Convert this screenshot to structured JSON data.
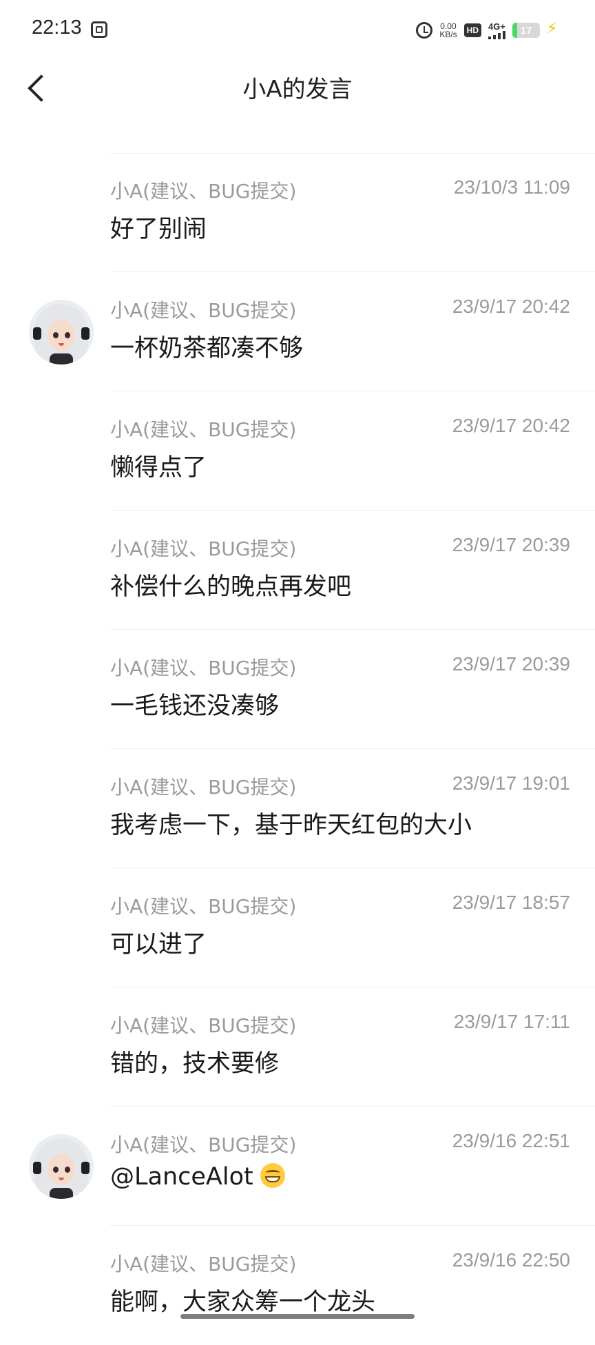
{
  "status_bar": {
    "time": "22:13",
    "net_speed_value": "0.00",
    "net_speed_unit": "KB/s",
    "hd_label": "HD",
    "network_label": "4G+",
    "battery_level": "17",
    "battery_fraction": 0.17
  },
  "header": {
    "title": "小A的发言"
  },
  "posts": [
    {
      "author": "小A(建议、BUG提交)",
      "time": "23/10/3 11:09",
      "content": "好了别闹",
      "avatar": false
    },
    {
      "author": "小A(建议、BUG提交)",
      "time": "23/9/17 20:42",
      "content": "一杯奶茶都凑不够",
      "avatar": true
    },
    {
      "author": "小A(建议、BUG提交)",
      "time": "23/9/17 20:42",
      "content": "懒得点了",
      "avatar": false
    },
    {
      "author": "小A(建议、BUG提交)",
      "time": "23/9/17 20:39",
      "content": "补偿什么的晚点再发吧",
      "avatar": false
    },
    {
      "author": "小A(建议、BUG提交)",
      "time": "23/9/17 20:39",
      "content": "一毛钱还没凑够",
      "avatar": false
    },
    {
      "author": "小A(建议、BUG提交)",
      "time": "23/9/17 19:01",
      "content": "我考虑一下，基于昨天红包的大小",
      "avatar": false
    },
    {
      "author": "小A(建议、BUG提交)",
      "time": "23/9/17 18:57",
      "content": "可以进了",
      "avatar": false
    },
    {
      "author": "小A(建议、BUG提交)",
      "time": "23/9/17 17:11",
      "content": "错的，技术要修",
      "avatar": false
    },
    {
      "author": "小A(建议、BUG提交)",
      "time": "23/9/16 22:51",
      "content": "@LanceAlot",
      "avatar": true,
      "emoji": "grinning-face-icon"
    },
    {
      "author": "小A(建议、BUG提交)",
      "time": "23/9/16 22:50",
      "content": "能啊，大家众筹一个龙头",
      "avatar": false
    }
  ]
}
